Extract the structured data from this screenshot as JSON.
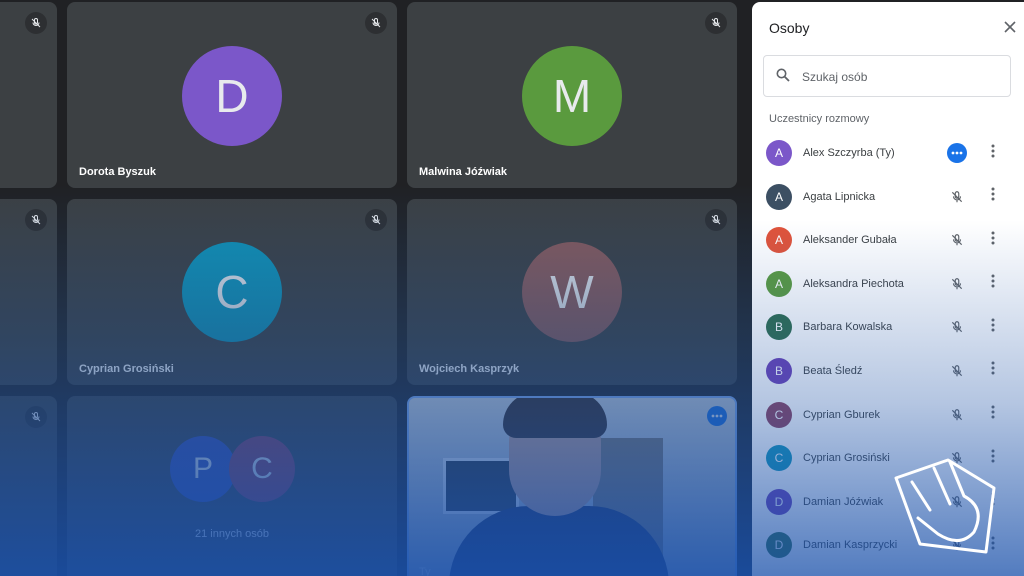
{
  "tiles": [
    {
      "name": "Dorota Byszuk",
      "initial": "D",
      "color": "#7b57c9"
    },
    {
      "name": "Malwina Jóźwiak",
      "initial": "M",
      "color": "#5a9a3e"
    },
    {
      "name": "Cyprian Grosiński",
      "initial": "C",
      "color": "#0f94b8"
    },
    {
      "name": "Wojciech Kasprzyk",
      "initial": "W",
      "color": "#8a5a5a"
    }
  ],
  "group_tile": {
    "initials": [
      "P",
      "C"
    ],
    "label": "21 innych osób"
  },
  "self_tile": {
    "label": "Ty"
  },
  "panel": {
    "title": "Osoby",
    "search_placeholder": "Szukaj osób",
    "section_label": "Uczestnicy rozmowy",
    "participants": [
      {
        "initial": "A",
        "name": "Alex Szczyrba (Ty)",
        "color": "#7b57c9",
        "status": "active"
      },
      {
        "initial": "A",
        "name": "Agata Lipnicka",
        "color": "#3c4f63",
        "status": "muted"
      },
      {
        "initial": "A",
        "name": "Aleksander Gubała",
        "color": "#e0533a",
        "status": "muted"
      },
      {
        "initial": "A",
        "name": "Aleksandra Piechota",
        "color": "#5a9a3e",
        "status": "muted"
      },
      {
        "initial": "B",
        "name": "Barbara Kowalska",
        "color": "#2d6b4c",
        "status": "muted"
      },
      {
        "initial": "B",
        "name": "Beata Śledź",
        "color": "#6a3fb5",
        "status": "muted"
      },
      {
        "initial": "C",
        "name": "Cyprian Gburek",
        "color": "#8a3e5c",
        "status": "muted"
      },
      {
        "initial": "C",
        "name": "Cyprian Grosiński",
        "color": "#0f94b8",
        "status": "muted"
      },
      {
        "initial": "D",
        "name": "Damian Jóźwiak",
        "color": "#6a3fb5",
        "status": "muted"
      },
      {
        "initial": "D",
        "name": "Damian Kasprzycki",
        "color": "#2d6b4c",
        "status": "muted"
      }
    ]
  },
  "colors": {
    "accent": "#1a73e8",
    "tile_bg": "#3c4043",
    "page_bg": "#202124"
  }
}
